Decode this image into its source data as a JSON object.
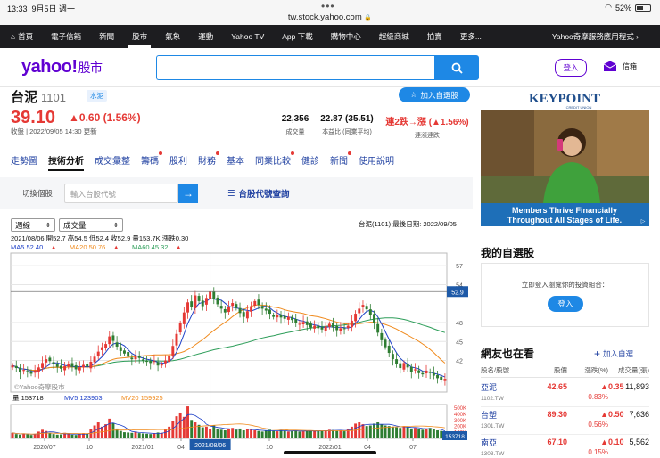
{
  "status_bar": {
    "time": "13:33",
    "date": "9月5日 週一",
    "url": "tw.stock.yahoo.com",
    "battery": "52%",
    "battery_level": 0.52
  },
  "nav": {
    "items": [
      "首頁",
      "電子信箱",
      "新聞",
      "股市",
      "氣象",
      "運動",
      "Yahoo TV",
      "App 下載",
      "購物中心",
      "超級商城",
      "拍賣",
      "更多..."
    ],
    "active": "股市",
    "app_link": "Yahoo奇摩服務應用程式"
  },
  "header": {
    "logo": "yahoo!",
    "logo_sub": "股市",
    "search_placeholder": "",
    "login": "登入",
    "mail": "信箱"
  },
  "stock": {
    "name": "台泥",
    "code": "1101",
    "industry": "水泥",
    "price": "39.10",
    "change": "0.60 (1.56%)",
    "update": "收盤 | 2022/09/05 14:30 更新",
    "add_watch": "加入自選股",
    "stats": [
      {
        "value": "22,356",
        "label": "成交量",
        "red": false
      },
      {
        "value": "22.87 (35.51)",
        "label": "本益比 (同業平均)",
        "red": false
      },
      {
        "value": "連2跌→漲 (▲1.56%)",
        "label": "連漲連跌",
        "red": true
      }
    ]
  },
  "tabs": [
    {
      "label": "走勢圖",
      "dot": false
    },
    {
      "label": "技術分析",
      "dot": false,
      "active": true
    },
    {
      "label": "成交彙整",
      "dot": false
    },
    {
      "label": "籌碼",
      "dot": true
    },
    {
      "label": "股利",
      "dot": false
    },
    {
      "label": "財務",
      "dot": true
    },
    {
      "label": "基本",
      "dot": false
    },
    {
      "label": "同業比較",
      "dot": true
    },
    {
      "label": "健診",
      "dot": false
    },
    {
      "label": "新聞",
      "dot": true
    },
    {
      "label": "使用說明",
      "dot": false
    }
  ],
  "switch": {
    "label": "切換個股",
    "placeholder": "輸入台股代號",
    "go": "→",
    "code_query": "台股代號查詢"
  },
  "chart_controls": {
    "period": "週線",
    "indicator": "成交量",
    "info": "台泥(1101)    最後日期: 2022/09/05"
  },
  "chart_header": {
    "ohlc": "2021/08/06 開52.7 高54.5 低52.4 收52.9 量153.7K 漲跌0.30",
    "ma5": "MA5 52.40",
    "ma20": "MA20 50.76",
    "ma60": "MA60 45.32",
    "watermark": "©Yahoo奇摩股市",
    "vol_legend": {
      "vol": "量 153718",
      "mv5": "MV5 123903",
      "mv20": "MV20 159925"
    },
    "cursor_price": "52.9",
    "cursor_date": "2021/08/06",
    "cursor_vol": "153718"
  },
  "chart_data": {
    "type": "candlestick",
    "price_axis": {
      "ticks": [
        57,
        54,
        48,
        45,
        42
      ],
      "ylim": [
        37,
        59
      ]
    },
    "volume_axis": {
      "ticks": [
        "500K",
        "400K",
        "300K",
        "200K",
        "100K"
      ],
      "ylim": [
        0,
        550
      ]
    },
    "x_ticks": [
      "2020/07",
      "10",
      "2021/01",
      "04",
      "07",
      "10",
      "2022/01",
      "04",
      "07"
    ],
    "colors": {
      "up": "#e53935",
      "down": "#2e7d32",
      "ma5": "#1e40c8",
      "ma20": "#f08a1c",
      "ma60": "#2e9e5a"
    },
    "closes": [
      41.2,
      40.8,
      40.1,
      40.5,
      40.2,
      39.9,
      40.4,
      40.9,
      41.6,
      42.2,
      41.9,
      41.4,
      41.0,
      40.7,
      41.1,
      41.5,
      41.0,
      40.6,
      40.9,
      41.3,
      41.0,
      41.8,
      42.6,
      43.4,
      44.1,
      44.6,
      45.8,
      45.1,
      44.2,
      43.5,
      43.1,
      42.6,
      42.2,
      42.6,
      42.4,
      42.0,
      41.8,
      41.6,
      41.9,
      41.2,
      41.4,
      42.0,
      42.8,
      44.3,
      46.2,
      47.9,
      49.6,
      51.2,
      50.5,
      52.3,
      51.4,
      50.6,
      51.9,
      52.9,
      51.8,
      50.9,
      50.2,
      49.6,
      50.4,
      51.1,
      50.3,
      49.5,
      48.9,
      49.8,
      50.6,
      51.4,
      50.8,
      50.2,
      49.9,
      49.4,
      48.9,
      49.2,
      48.8,
      48.6,
      48.9,
      48.4,
      48.0,
      47.8,
      48.1,
      47.6,
      47.2,
      47.5,
      47.1,
      46.9,
      47.4,
      47.8,
      47.2,
      46.8,
      47.1,
      47.0,
      47.5,
      48.3,
      49.4,
      50.2,
      50.8,
      50.1,
      49.2,
      48.0,
      46.4,
      45.2,
      44.1,
      43.2,
      42.2,
      41.4,
      40.8,
      41.6,
      40.9,
      40.2,
      40.6,
      40.0,
      39.8,
      40.4,
      40.1,
      39.6,
      39.2,
      38.9,
      39.1
    ],
    "volumes_k": [
      90,
      70,
      60,
      80,
      65,
      55,
      75,
      110,
      140,
      120,
      80,
      70,
      60,
      65,
      90,
      75,
      60,
      55,
      70,
      85,
      80,
      150,
      210,
      260,
      190,
      230,
      320,
      250,
      160,
      120,
      100,
      95,
      90,
      110,
      85,
      80,
      75,
      70,
      85,
      95,
      90,
      140,
      190,
      280,
      360,
      420,
      350,
      520,
      300,
      260,
      220,
      180,
      190,
      153.7,
      210,
      160,
      140,
      130,
      150,
      170,
      140,
      160,
      130,
      150,
      140,
      130,
      120,
      110,
      130,
      140,
      120,
      115,
      130,
      120,
      110,
      125,
      130,
      110,
      115,
      120,
      130,
      120,
      115,
      125,
      130,
      140,
      135,
      120,
      130,
      115,
      150,
      190,
      240,
      260,
      230,
      200,
      210,
      240,
      260,
      230,
      210,
      200,
      190,
      180,
      170,
      200,
      180,
      160,
      170,
      150,
      140,
      160,
      170,
      150,
      130,
      120,
      22
    ]
  },
  "right": {
    "ad": {
      "brand": "KEYPOINT",
      "brand_sub": "CREDIT UNION",
      "line1": "Members Thrive Financially",
      "line2": "Throughout All Stages of Life."
    },
    "mywatch": {
      "title": "我的自選股",
      "msg": "立即登入瀏覽你的投資組合：",
      "login": "登入"
    },
    "netizen": {
      "title": "網友也在看",
      "add": "加入自選",
      "headers": [
        "股名/股號",
        "股價",
        "漲跌(%)",
        "成交量(張)"
      ],
      "rows": [
        {
          "name": "亞泥",
          "code": "1102.TW",
          "price": "42.65",
          "change": "0.35",
          "pct": "0.83%",
          "volume": "11,893"
        },
        {
          "name": "台塑",
          "code": "1301.TW",
          "price": "89.30",
          "change": "0.50",
          "pct": "0.56%",
          "volume": "7,636"
        },
        {
          "name": "南亞",
          "code": "1303.TW",
          "price": "67.10",
          "change": "0.10",
          "pct": "0.15%",
          "volume": "5,562"
        }
      ]
    }
  }
}
